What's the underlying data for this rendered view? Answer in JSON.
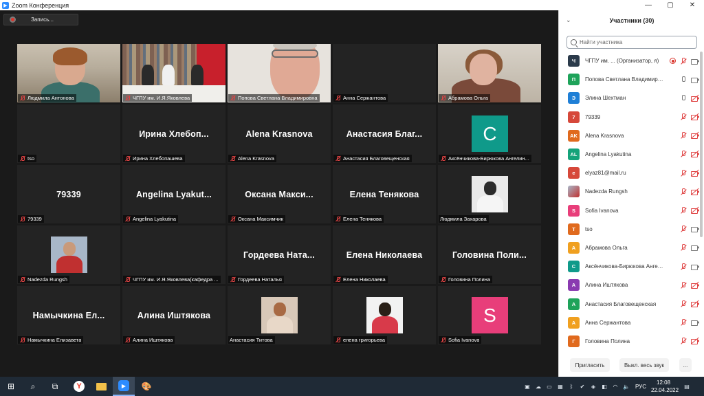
{
  "window": {
    "title": "Zoom Конференция",
    "controls": [
      "minimize",
      "maximize",
      "close"
    ]
  },
  "recording": {
    "label": "Запись..."
  },
  "tiles": [
    {
      "name": "Людмила Антонова",
      "big": "",
      "kind": "photo1"
    },
    {
      "name": "ЧГПУ им. И.Я.Яковлева",
      "big": "",
      "kind": "photo2"
    },
    {
      "name": "Попова Светлана Владимировна",
      "big": "",
      "kind": "photo3",
      "active": true
    },
    {
      "name": "Анна Сержантова",
      "big": "",
      "kind": "blank"
    },
    {
      "name": "Абрамова Ольга",
      "big": "",
      "kind": "photo4"
    },
    {
      "name": "tso",
      "big": "",
      "kind": "blank"
    },
    {
      "name": "Ирина Хлебопашева",
      "big": "Ирина Хлебоп...",
      "kind": "text"
    },
    {
      "name": "Alena Krasnova",
      "big": "Alena Krasnova",
      "kind": "text"
    },
    {
      "name": "Анастасия Благовещенская",
      "big": "Анастасия Благ...",
      "kind": "text"
    },
    {
      "name": "Аксёнчикова-Бирюкова Ангелин...",
      "big": "",
      "kind": "avatar",
      "letter": "С",
      "color": "#0f9a8a"
    },
    {
      "name": "79339",
      "big": "79339",
      "kind": "text"
    },
    {
      "name": "Angelina Lyakutina",
      "big": "Angelina Lyakut...",
      "kind": "text"
    },
    {
      "name": "Оксана Максимчик",
      "big": "Оксана Макси...",
      "kind": "text"
    },
    {
      "name": "Елена Тенякова",
      "big": "Елена Тенякова",
      "kind": "text"
    },
    {
      "name": "Людмила Захарова",
      "big": "",
      "kind": "mini",
      "bg": "#e9e9e9",
      "hd": "#2b2b2b",
      "bd": "#f5f5f5",
      "muted": false
    },
    {
      "name": "Nadezda Rungsh",
      "big": "",
      "kind": "mini",
      "bg": "#a8b7c8",
      "hd": "#c99a7a",
      "bd": "#c03030"
    },
    {
      "name": "ЧГПУ им. И.Я.Яковлева(кафедра ...",
      "big": "",
      "kind": "blank"
    },
    {
      "name": "Гордеева Наталья",
      "big": "Гордеева Ната...",
      "kind": "text"
    },
    {
      "name": "Елена Николаева",
      "big": "Елена Николаева",
      "kind": "text"
    },
    {
      "name": "Головина Полина",
      "big": "Головина Поли...",
      "kind": "text"
    },
    {
      "name": "Намычкина Елизавета",
      "big": "Намычкина Ел...",
      "kind": "text"
    },
    {
      "name": "Алина Иштякова",
      "big": "Алина Иштякова",
      "kind": "text"
    },
    {
      "name": "Анастасия Титова",
      "big": "",
      "kind": "mini",
      "bg": "#d8c8b8",
      "hd": "#a86a44",
      "bd": "#e8d8c8",
      "muted": false
    },
    {
      "name": "елена григорьева",
      "big": "",
      "kind": "mini",
      "bg": "#f2f2f2",
      "hd": "#2a2018",
      "bd": "#d83a4a"
    },
    {
      "name": "Sofia Ivanova",
      "big": "",
      "kind": "avatar",
      "letter": "S",
      "color": "#e83e7a"
    }
  ],
  "sidebar": {
    "title": "Участники (30)",
    "search_placeholder": "Найти участника",
    "participants": [
      {
        "initials": "Ч",
        "name": "ЧГПУ им. ...  (Организатор, я)",
        "color": "#2b3a4a",
        "rec": true,
        "mic": "muted",
        "cam": "on"
      },
      {
        "initials": "П",
        "name": "Попова Светлана Владимировна",
        "color": "#1ea35a",
        "mic": "on",
        "cam": "on"
      },
      {
        "initials": "Э",
        "name": "Элина Шехтман",
        "color": "#1f7fd6",
        "mic": "on",
        "cam": "off"
      },
      {
        "initials": "7",
        "name": "79339",
        "color": "#d6483a",
        "mic": "muted",
        "cam": "off"
      },
      {
        "initials": "AK",
        "name": "Alena Krasnova",
        "color": "#e06a1e",
        "mic": "muted",
        "cam": "off"
      },
      {
        "initials": "AL",
        "name": "Angelina Lyakutina",
        "color": "#14a37a",
        "mic": "muted",
        "cam": "off"
      },
      {
        "initials": "e",
        "name": "elyaz81@mail.ru",
        "color": "#d6483a",
        "mic": "muted",
        "cam": "off"
      },
      {
        "initials": "",
        "name": "Nadezda Rungsh",
        "color": "#8a6a6a",
        "mic": "muted",
        "cam": "off",
        "photo": true
      },
      {
        "initials": "S",
        "name": "Sofia Ivanova",
        "color": "#e83e7a",
        "mic": "muted",
        "cam": "off"
      },
      {
        "initials": "T",
        "name": "tso",
        "color": "#e06a1e",
        "mic": "muted",
        "cam": "on"
      },
      {
        "initials": "А",
        "name": "Абрамова Ольга",
        "color": "#f0a020",
        "mic": "muted",
        "cam": "on"
      },
      {
        "initials": "С",
        "name": "Аксёнчикова-Бирюкова Ангели...",
        "color": "#0f9a8a",
        "mic": "muted",
        "cam": "on"
      },
      {
        "initials": "А",
        "name": "Алина Иштякова",
        "color": "#8a3ab0",
        "mic": "muted",
        "cam": "off"
      },
      {
        "initials": "А",
        "name": "Анастасия Благовещенская",
        "color": "#1ea35a",
        "mic": "muted",
        "cam": "off"
      },
      {
        "initials": "А",
        "name": "Анна Сержантова",
        "color": "#f0a020",
        "mic": "muted",
        "cam": "on"
      },
      {
        "initials": "Г",
        "name": "Головина Полина",
        "color": "#e06a1e",
        "mic": "muted",
        "cam": "off"
      }
    ],
    "footer": {
      "invite": "Пригласить",
      "mute_all": "Выкл. весь звук",
      "more": "..."
    }
  },
  "taskbar": {
    "lang": "РУС",
    "time": "12:08",
    "date": "22.04.2022"
  }
}
